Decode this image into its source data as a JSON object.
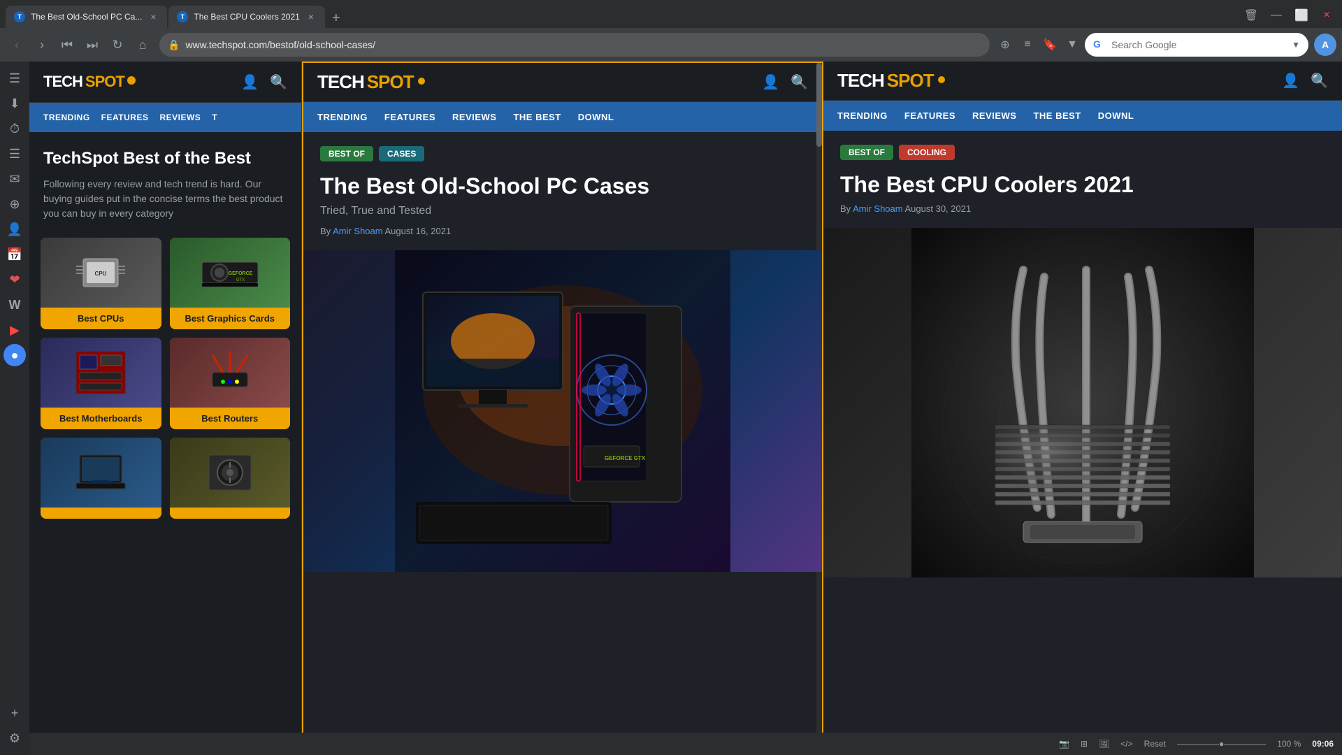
{
  "browser": {
    "tabs": [
      {
        "id": "tab1",
        "title": "The Best Old-School PC Ca...",
        "url": "www.techspot.com/bestof/old-school-cases/",
        "active": false,
        "favicon_color": "#4285f4"
      },
      {
        "id": "tab2",
        "title": "The Best CPU Coolers 2021",
        "active": true,
        "favicon_color": "#4285f4"
      }
    ],
    "address_bar": {
      "url": "www.techspot.com/bestof/old-school-cases/",
      "lock_icon": "🔒"
    },
    "search": {
      "placeholder": "Search Google",
      "value": "Search Google"
    }
  },
  "sidebar_icons": [
    {
      "name": "sidebar-nav",
      "icon": "☰"
    },
    {
      "name": "sidebar-downloads",
      "icon": "⬇"
    },
    {
      "name": "sidebar-history",
      "icon": "⏱"
    },
    {
      "name": "sidebar-bookmarks",
      "icon": "☰"
    },
    {
      "name": "sidebar-mail",
      "icon": "✉"
    },
    {
      "name": "sidebar-rss",
      "icon": "⊕"
    },
    {
      "name": "sidebar-user",
      "icon": "👤"
    },
    {
      "name": "sidebar-calendar",
      "icon": "📅"
    },
    {
      "name": "sidebar-vivaldi",
      "icon": "❤"
    },
    {
      "name": "sidebar-wikipedia",
      "icon": "W"
    },
    {
      "name": "sidebar-youtube",
      "icon": "▶"
    },
    {
      "name": "sidebar-active",
      "icon": "●"
    },
    {
      "name": "sidebar-add",
      "icon": "+"
    }
  ],
  "panel_left": {
    "logo": "TECHSPOT",
    "nav_items": [
      "TRENDING",
      "FEATURES",
      "REVIEWS",
      "T"
    ],
    "hero_title": "TechSpot Best of the Best",
    "hero_desc": "Following every review and tech trend is hard. Our buying guides put in the concise terms the best product you can buy in every category",
    "cards": [
      {
        "label": "Best CPUs",
        "type": "cpu"
      },
      {
        "label": "Best Graphics Cards",
        "type": "gpu"
      },
      {
        "label": "Best Motherboards",
        "type": "mobo"
      },
      {
        "label": "Best Routers",
        "type": "router"
      },
      {
        "label": "",
        "type": "laptop"
      },
      {
        "label": "",
        "type": "psu"
      }
    ]
  },
  "panel_center": {
    "logo": "TECHSPOT",
    "nav_items": [
      "TRENDING",
      "FEATURES",
      "REVIEWS",
      "THE BEST",
      "DOWNL"
    ],
    "tag1": "BEST OF",
    "tag2": "CASES",
    "article_title": "The Best Old-School PC Cases",
    "article_subtitle": "Tried, True and Tested",
    "author": "Amir Shoam",
    "date": "August 16, 2021",
    "by_label": "By"
  },
  "panel_right": {
    "logo": "TECHSPOT",
    "nav_items": [
      "TRENDING",
      "FEATURES",
      "REVIEWS",
      "THE BEST",
      "DOWNL"
    ],
    "tag1": "BEST OF",
    "tag2": "COOLING",
    "article_title": "The Best CPU Coolers 2021",
    "author": "Amir Shoam",
    "date": "August 30, 2021",
    "by_label": "By"
  },
  "status_bar": {
    "reset_label": "Reset",
    "zoom": "100 %",
    "time": "09:06"
  }
}
